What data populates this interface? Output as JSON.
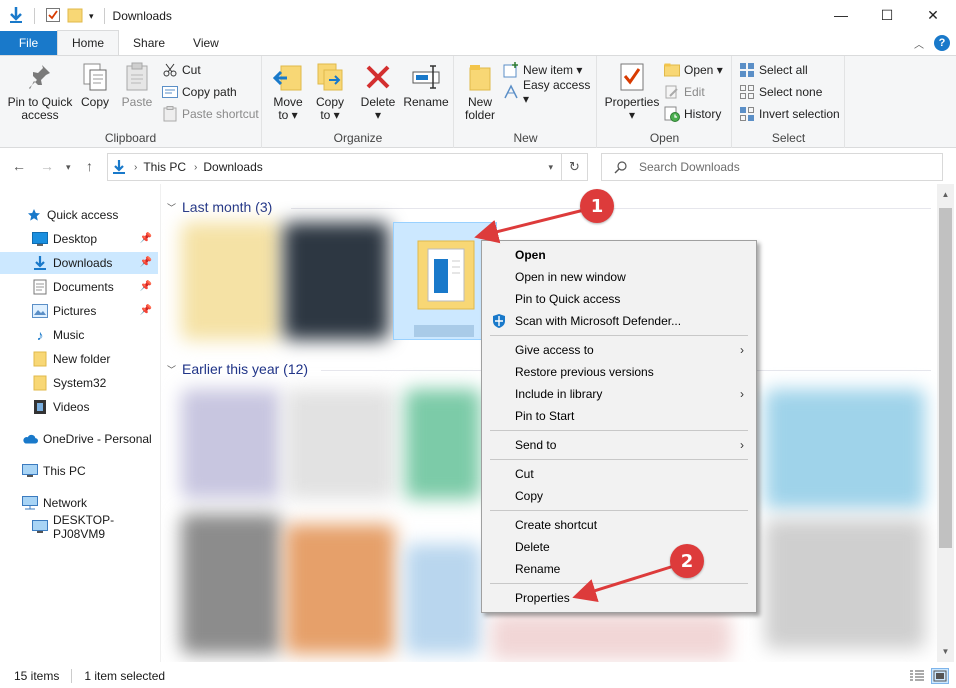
{
  "window": {
    "title": "Downloads",
    "minimize_glyph": "—",
    "maximize_glyph": "☐",
    "close_glyph": "✕"
  },
  "tabs": [
    {
      "label": "File"
    },
    {
      "label": "Home"
    },
    {
      "label": "Share"
    },
    {
      "label": "View"
    }
  ],
  "ribbon": {
    "clipboard": {
      "label": "Clipboard",
      "pin_line1": "Pin to Quick",
      "pin_line2": "access",
      "copy": "Copy",
      "paste": "Paste",
      "cut": "Cut",
      "copy_path": "Copy path",
      "paste_shortcut": "Paste shortcut"
    },
    "organize": {
      "label": "Organize",
      "move_to": "Move",
      "move_to2": "to ▾",
      "copy_to": "Copy",
      "copy_to2": "to ▾",
      "delete": "Delete",
      "delete2": "▾",
      "rename": "Rename"
    },
    "new": {
      "label": "New",
      "new_folder1": "New",
      "new_folder2": "folder",
      "new_item": "New item ▾",
      "easy_access": "Easy access ▾"
    },
    "open": {
      "label": "Open",
      "properties": "Properties",
      "properties2": "▾",
      "open": "Open ▾",
      "edit": "Edit",
      "history": "History"
    },
    "select": {
      "label": "Select",
      "select_all": "Select all",
      "select_none": "Select none",
      "invert": "Invert selection"
    }
  },
  "address": {
    "crumbs": [
      "This PC",
      "Downloads"
    ],
    "search_placeholder": "Search Downloads"
  },
  "nav": {
    "items": [
      {
        "label": "Quick access"
      },
      {
        "label": "Desktop"
      },
      {
        "label": "Downloads"
      },
      {
        "label": "Documents"
      },
      {
        "label": "Pictures"
      },
      {
        "label": "Music"
      },
      {
        "label": "New folder"
      },
      {
        "label": "System32"
      },
      {
        "label": "Videos"
      },
      {
        "label": "OneDrive - Personal"
      },
      {
        "label": "This PC"
      },
      {
        "label": "Network"
      },
      {
        "label": "DESKTOP-PJ08VM9"
      }
    ]
  },
  "content": {
    "group1": "Last month (3)",
    "group2": "Earlier this year (12)"
  },
  "context_menu": {
    "items": [
      "Open",
      "Open in new window",
      "Pin to Quick access",
      "Scan with Microsoft Defender...",
      "Give access to",
      "Restore previous versions",
      "Include in library",
      "Pin to Start",
      "Send to",
      "Cut",
      "Copy",
      "Create shortcut",
      "Delete",
      "Rename",
      "Properties"
    ],
    "submenu_arrow": "›"
  },
  "callouts": {
    "one": "1",
    "two": "2",
    "color": "#dd3b3b"
  },
  "status": {
    "items": "15 items",
    "selected": "1 item selected"
  },
  "colors": {
    "accent": "#1979ca",
    "selection": "#cce8ff",
    "group_header": "#1e3287"
  }
}
